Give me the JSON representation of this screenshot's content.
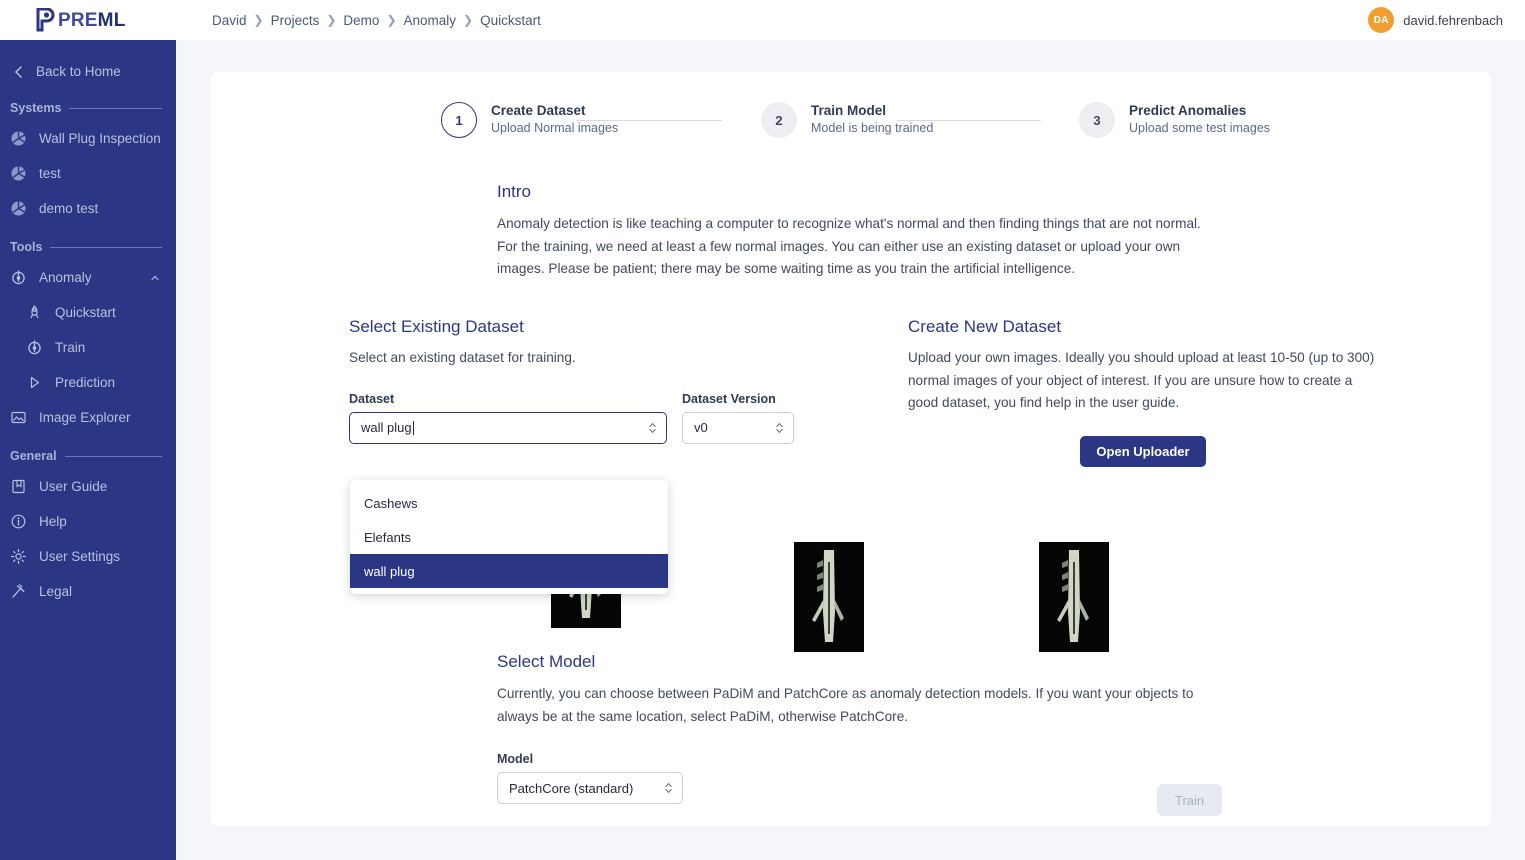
{
  "brand": {
    "pre": "PRE",
    "ml": "ML",
    "logo_icon": "preml-p-logo"
  },
  "breadcrumb": [
    "David",
    "Projects",
    "Demo",
    "Anomaly",
    "Quickstart"
  ],
  "user": {
    "initials": "DA",
    "name": "david.fehrenbach"
  },
  "sidebar": {
    "back": {
      "label": "Back to Home",
      "icon": "chevron-left-icon"
    },
    "sections": [
      {
        "label": "Systems",
        "items": [
          {
            "label": "Wall Plug Inspection",
            "icon": "aperture-icon"
          },
          {
            "label": "test",
            "icon": "aperture-icon"
          },
          {
            "label": "demo test",
            "icon": "aperture-icon"
          }
        ]
      },
      {
        "label": "Tools",
        "items": [
          {
            "label": "Anomaly",
            "icon": "anomaly-icon",
            "caret": "chevron-up-icon",
            "expanded": true
          },
          {
            "label": "Quickstart",
            "icon": "rocket-icon",
            "sub": true
          },
          {
            "label": "Train",
            "icon": "anomaly-icon",
            "sub": true
          },
          {
            "label": "Prediction",
            "icon": "play-icon",
            "sub": true
          },
          {
            "label": "Image Explorer",
            "icon": "image-icon"
          }
        ]
      },
      {
        "label": "General",
        "items": [
          {
            "label": "User Guide",
            "icon": "book-icon"
          },
          {
            "label": "Help",
            "icon": "info-circle-icon"
          },
          {
            "label": "User Settings",
            "icon": "gear-icon"
          },
          {
            "label": "Legal",
            "icon": "gavel-icon"
          }
        ]
      }
    ]
  },
  "stepper": [
    {
      "num": "1",
      "title": "Create Dataset",
      "sub": "Upload Normal images",
      "state": "active"
    },
    {
      "num": "2",
      "title": "Train Model",
      "sub": "Model is being trained",
      "state": "idle"
    },
    {
      "num": "3",
      "title": "Predict Anomalies",
      "sub": "Upload some test images",
      "state": "idle"
    }
  ],
  "intro": {
    "heading": "Intro",
    "body": "Anomaly detection is like teaching a computer to recognize what's normal and then finding things that are not normal. For the training, we need at least a few normal images. You can either use an existing dataset or upload your own images. Please be patient; there may be some waiting time as you train the artificial intelligence."
  },
  "select_existing": {
    "heading": "Select Existing Dataset",
    "body": "Select an existing dataset for training.",
    "dataset_label": "Dataset",
    "dataset_value": "wall plug",
    "dataset_options": [
      "Cashews",
      "Elefants",
      "wall plug"
    ],
    "dataset_selected": "wall plug",
    "version_label": "Dataset Version",
    "version_value": "v0"
  },
  "create_new": {
    "heading": "Create New Dataset",
    "body": "Upload your own images. Ideally you should upload at least 10-50 (up to 300) normal images of your object of interest. If you are unsure how to create a good dataset, you find help in the user guide.",
    "button": "Open Uploader"
  },
  "select_model": {
    "heading": "Select Model",
    "body": "Currently, you can choose between PaDiM and PatchCore as anomaly detection models. If you want your objects to always be at the same location, select PaDiM, otherwise PatchCore.",
    "model_label": "Model",
    "model_value": "PatchCore (standard)",
    "train_button": "Train"
  },
  "thumbnails": [
    {
      "alt": "wall-plug-sample-1"
    },
    {
      "alt": "wall-plug-sample-2"
    },
    {
      "alt": "wall-plug-sample-3"
    }
  ],
  "colors": {
    "brand_dark": "#2b3784",
    "sidebar": "#2b3784",
    "page_bg": "#f5f6fa",
    "accent_orange": "#f0a030"
  }
}
